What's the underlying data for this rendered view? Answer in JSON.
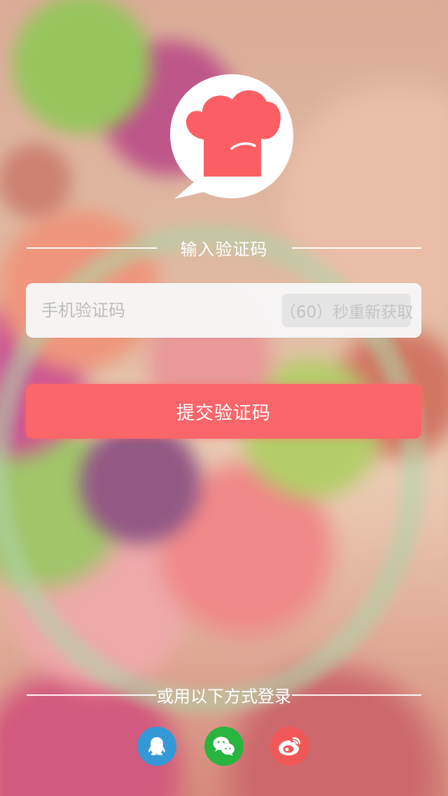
{
  "brand_color": "#fa6669",
  "header": {
    "title": "输入验证码"
  },
  "verify": {
    "placeholder": "手机验证码",
    "resend_label": "（60）秒重新获取"
  },
  "actions": {
    "submit_label": "提交验证码"
  },
  "login_options": {
    "label": "或用以下方式登录",
    "providers": [
      {
        "name": "QQ",
        "icon": "qq-icon",
        "color": "#3598d6"
      },
      {
        "name": "WeChat",
        "icon": "wechat-icon",
        "color": "#28b53f"
      },
      {
        "name": "Weibo",
        "icon": "weibo-icon",
        "color": "#f05858"
      }
    ]
  }
}
